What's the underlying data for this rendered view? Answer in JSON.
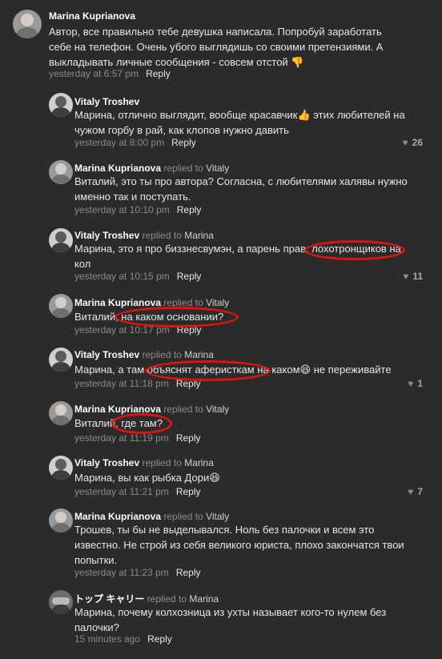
{
  "replied_to": "replied to",
  "reply_label": "Reply",
  "comments": [
    {
      "author": "Marina Kuprianova",
      "target": "",
      "text": "Автор, все правильно тебе девушка написала. Попробуй заработать себе на телефон. Очень убого выглядишь со своими претензиями. А выкладывать личные сообщения - совсем отстой 👎",
      "time": "yesterday at 6:57 pm",
      "likes": ""
    },
    {
      "author": "Vitaly Troshev",
      "target": "",
      "text": "Марина, отлично выглядит, вообще красавчик👍 этих любителей на чужом горбу в рай, как клопов нужно давить",
      "time": "yesterday at 8:00 pm",
      "likes": "26"
    },
    {
      "author": "Marina Kuprianova",
      "target": "Vitaly",
      "text": "Виталий, это ты про автора? Согласна, с любителями халявы нужно именно так и поступать.",
      "time": "yesterday at 10:10 pm",
      "likes": ""
    },
    {
      "author": "Vitaly Troshev",
      "target": "Marina",
      "text": "Марина, это я про биззнесвумэн, а парень прав, лохотронщиков на кол",
      "time": "yesterday at 10:15 pm",
      "likes": "11"
    },
    {
      "author": "Marina Kuprianova",
      "target": "Vitaly",
      "text": "Виталий, на каком основании?",
      "time": "yesterday at 10:17 pm",
      "likes": ""
    },
    {
      "author": "Vitaly Troshev",
      "target": "Marina",
      "text": "Марина, а там объяснят аферисткам на каком😆 не переживайте",
      "time": "yesterday at 11:18 pm",
      "likes": "1"
    },
    {
      "author": "Marina Kuprianova",
      "target": "Vitaly",
      "text": "Виталий, где там?",
      "time": "yesterday at 11:19 pm",
      "likes": ""
    },
    {
      "author": "Vitaly Troshev",
      "target": "Marina",
      "text": "Марина, вы как рыбка Дори😆",
      "time": "yesterday at 11:21 pm",
      "likes": "7"
    },
    {
      "author": "Marina Kuprianova",
      "target": "Vitaly",
      "text": "Трошев, ты бы не выделывался. Ноль без палочки и всем это известно. Не строй из себя великого юриста, плохо закончатся твои попытки.",
      "time": "yesterday at 11:23 pm",
      "likes": ""
    },
    {
      "author": "トップ キャリー",
      "target": "Marina",
      "text": "Марина, почему колхозница из ухты называет кого-то нулем без палочки?",
      "time": "15 minutes ago",
      "likes": ""
    }
  ],
  "colors": {
    "background": "#2b2b2b",
    "annotation_red": "#e0140f"
  }
}
